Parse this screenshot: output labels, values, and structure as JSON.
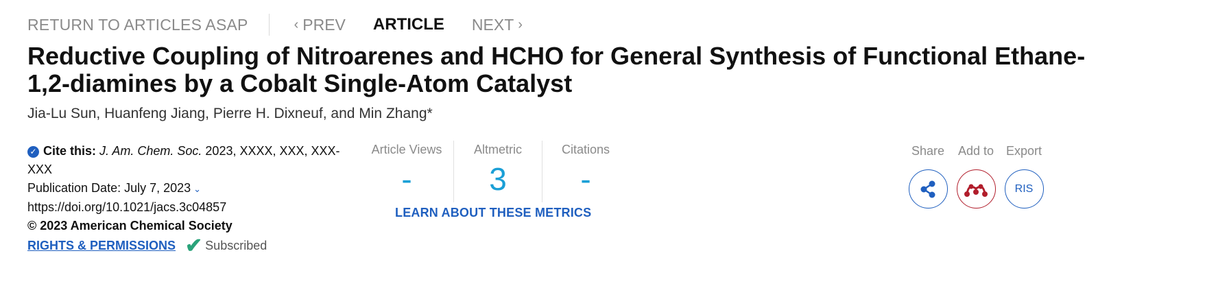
{
  "nav": {
    "return_label": "RETURN TO ARTICLES ASAP",
    "prev_label": "PREV",
    "article_label": "ARTICLE",
    "next_label": "NEXT"
  },
  "article": {
    "title": "Reductive Coupling of Nitroarenes and HCHO for General Synthesis of Functional Ethane-1,2-diamines by a Cobalt Single-Atom Catalyst",
    "authors": "Jia-Lu Sun, Huanfeng Jiang, Pierre H. Dixneuf, and Min Zhang*"
  },
  "meta": {
    "cite_label": "Cite this:",
    "journal": "J. Am. Chem. Soc.",
    "citation_rest": "2023, XXXX, XXX, XXX-XXX",
    "publication_date": "Publication Date: July 7, 2023",
    "doi": "https://doi.org/10.1021/jacs.3c04857",
    "copyright": "© 2023 American Chemical Society",
    "rights_label": "RIGHTS & PERMISSIONS",
    "subscribed_label": "Subscribed"
  },
  "metrics": {
    "views_label": "Article Views",
    "views_value": "-",
    "altmetric_label": "Altmetric",
    "altmetric_value": "3",
    "citations_label": "Citations",
    "citations_value": "-",
    "learn_label": "LEARN ABOUT THESE METRICS"
  },
  "actions": {
    "share_label": "Share",
    "add_label": "Add to",
    "export_label": "Export",
    "export_button_text": "RIS"
  },
  "colors": {
    "accent_blue": "#1f5fbf",
    "metric_blue": "#1a9fd6",
    "mendeley_red": "#b11d2b",
    "subscribed_green": "#2aa37a"
  },
  "icons": [
    "check-circle-icon",
    "chevron-left-icon",
    "chevron-right-icon",
    "chevron-down-icon",
    "checkmark-icon",
    "share-icon",
    "mendeley-icon"
  ]
}
